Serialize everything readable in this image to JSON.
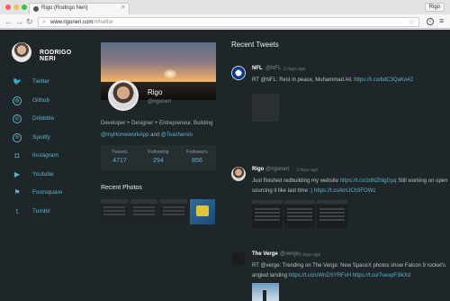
{
  "browser": {
    "tab_title": "Rigo (Rodrigo Neri)",
    "tab_close": "×",
    "profile_label": "Rigo",
    "url_host": "www.rigoneri.com",
    "url_path": "/#/twitter",
    "nav_back": "←",
    "nav_forward": "→",
    "nav_reload": "↻",
    "star_icon": "☆",
    "ext_icon": "i",
    "menu_icon": "≡"
  },
  "sidebar": {
    "name": "RODRIGO NERI",
    "items": [
      {
        "label": "Twitter",
        "icon": "twitter-icon",
        "glyph": "🐦"
      },
      {
        "label": "Github",
        "icon": "github-icon",
        "glyph": "◍"
      },
      {
        "label": "Dribbble",
        "icon": "dribbble-icon",
        "glyph": "◎"
      },
      {
        "label": "Spotify",
        "icon": "spotify-icon",
        "glyph": "≋"
      },
      {
        "label": "Instagram",
        "icon": "instagram-icon",
        "glyph": "◘"
      },
      {
        "label": "Youtube",
        "icon": "youtube-icon",
        "glyph": "▶"
      },
      {
        "label": "Foursquare",
        "icon": "foursquare-icon",
        "glyph": "⚑"
      },
      {
        "label": "Tumblr",
        "icon": "tumblr-icon",
        "glyph": "t"
      }
    ]
  },
  "profile": {
    "name": "Rigo",
    "handle": "@rigoneri",
    "bio_1": "Developer + Designer + Entrepreneur. Building",
    "bio_link_1": "@myHomeworkApp",
    "bio_and": " and ",
    "bio_link_2": "@Teachersio",
    "stats": [
      {
        "label": "Tweets",
        "value": "4717"
      },
      {
        "label": "Following",
        "value": "294"
      },
      {
        "label": "Followers",
        "value": "856"
      }
    ]
  },
  "photos": {
    "title": "Recent Photos"
  },
  "tweets": {
    "title": "Recent Tweets",
    "items": [
      {
        "name": "NFL",
        "handle": "@NFL",
        "time": "3 days ago",
        "text": "RT @NFL: Rest in peace, Muhammad Ali. ",
        "link": "https://t.co/bdC3QaKo42"
      },
      {
        "name": "Rigo",
        "handle": "@rigoneri",
        "time": "3 days ago",
        "text": "Just finished redbuilding my website ",
        "link": "https://t.co/zdNZhlgGyq",
        "text2": " Still working on open sourcing it like last time ",
        "link2": ":) https://t.co/kmJCh3FOWz"
      },
      {
        "name": "The Verge",
        "handle": "@verge",
        "time": "3 days ago",
        "text": "RT @verge: Trending on The Verge: New SpaceX photos show Falcon 9 rocket's angled landing ",
        "link": "https://t.co/uWnDSYRFxH https://t.co/7uexpF3ikXd"
      }
    ]
  },
  "colors": {
    "background": "#1f2629",
    "accent": "#5eb4c7",
    "panel": "#262e32"
  }
}
